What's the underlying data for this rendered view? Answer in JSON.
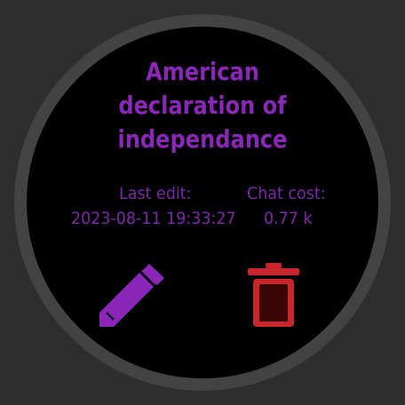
{
  "note": {
    "title_lines": [
      "American",
      "declaration of",
      "independance"
    ]
  },
  "meta": {
    "last_edit_label": "Last edit:",
    "last_edit_value": "2023-08-11 19:33:27",
    "chat_cost_label": "Chat cost:",
    "chat_cost_value": "0.77 k"
  },
  "actions": {
    "edit_icon": "pencil-icon",
    "delete_icon": "trash-icon"
  },
  "colors": {
    "title": "#8a26b8",
    "meta": "#7a2aa8",
    "edit": "#8a26b8",
    "delete": "#c8262b",
    "screen": "#000000",
    "bezel": "#434343",
    "background": "#2e2e2e"
  }
}
